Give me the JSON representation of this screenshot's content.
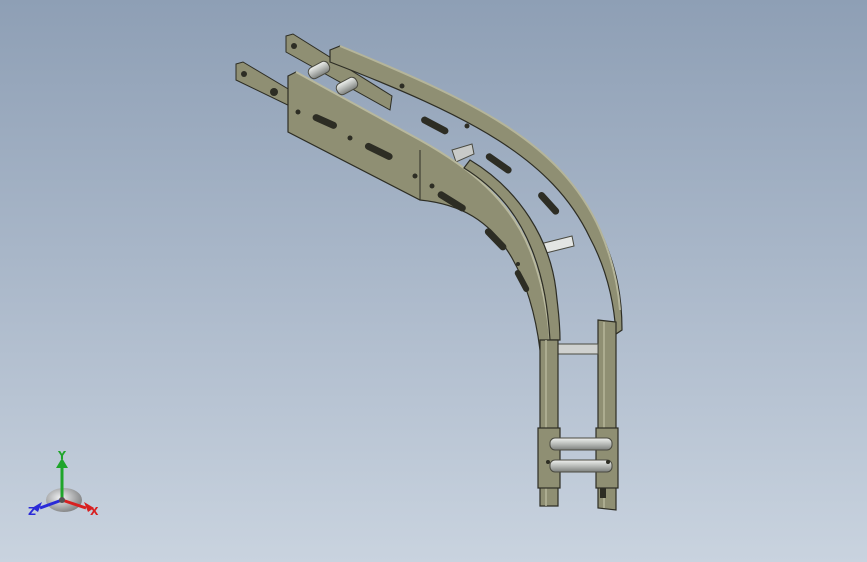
{
  "viewport": {
    "background_top": "#8e9fb5",
    "background_bottom": "#c9d3df",
    "model_color": "#8f8f73",
    "model_edge_color": "#2d2d24",
    "roller_color": "#c8cac8"
  },
  "triad": {
    "x_label": "X",
    "y_label": "Y",
    "z_label": "Z",
    "x_color": "#d82020",
    "y_color": "#1fa52b",
    "z_color": "#2a2ad8"
  }
}
